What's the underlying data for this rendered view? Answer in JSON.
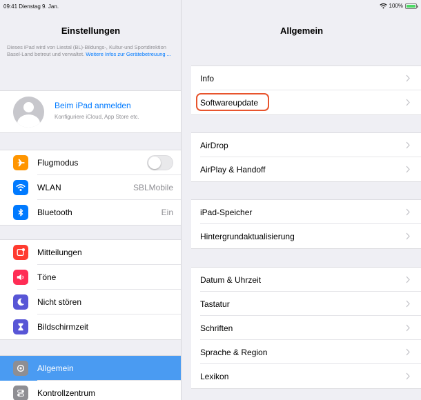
{
  "status_bar": {
    "time_date": "09:41  Dienstag 9. Jan.",
    "battery": "100%"
  },
  "left": {
    "title": "Einstellungen",
    "note_text": "Dieses iPad wird von Liestal (BL)-Bildungs-, Kultur-und Sportdirektion Basel-Land betreut und verwaltet.",
    "note_link": "Weitere Infos zur Gerätebetreuung ...",
    "profile": {
      "title": "Beim iPad anmelden",
      "subtitle": "Konfiguriere iCloud, App Store etc."
    },
    "groups": [
      [
        {
          "label": "Flugmodus",
          "icon": "airplane-icon",
          "color": "#ff9500",
          "control": "toggle"
        },
        {
          "label": "WLAN",
          "icon": "wifi-icon",
          "color": "#007aff",
          "value": "SBLMobile"
        },
        {
          "label": "Bluetooth",
          "icon": "bluetooth-icon",
          "color": "#007aff",
          "value": "Ein"
        }
      ],
      [
        {
          "label": "Mitteilungen",
          "icon": "notifications-icon",
          "color": "#ff3b30"
        },
        {
          "label": "Töne",
          "icon": "sound-icon",
          "color": "#ff2d55"
        },
        {
          "label": "Nicht stören",
          "icon": "moon-icon",
          "color": "#5856d6"
        },
        {
          "label": "Bildschirmzeit",
          "icon": "hourglass-icon",
          "color": "#5856d6"
        }
      ],
      [
        {
          "label": "Allgemein",
          "icon": "gear-icon",
          "color": "#8e8e93",
          "selected": true
        },
        {
          "label": "Kontrollzentrum",
          "icon": "toggles-icon",
          "color": "#8e8e93"
        }
      ]
    ]
  },
  "right": {
    "title": "Allgemein",
    "groups": [
      [
        {
          "label": "Info"
        },
        {
          "label": "Softwareupdate",
          "highlighted": true
        }
      ],
      [
        {
          "label": "AirDrop"
        },
        {
          "label": "AirPlay & Handoff"
        }
      ],
      [
        {
          "label": "iPad-Speicher"
        },
        {
          "label": "Hintergrundaktualisierung"
        }
      ],
      [
        {
          "label": "Datum & Uhrzeit"
        },
        {
          "label": "Tastatur"
        },
        {
          "label": "Schriften"
        },
        {
          "label": "Sprache & Region"
        },
        {
          "label": "Lexikon"
        }
      ]
    ]
  }
}
